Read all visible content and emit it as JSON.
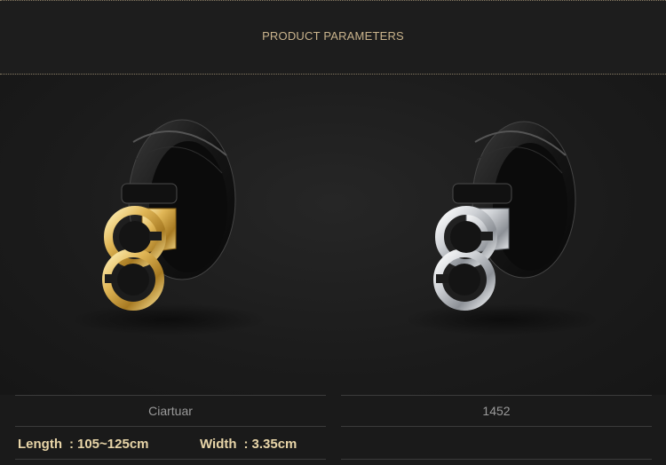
{
  "header": {
    "title": "PRODUCT PARAMETERS"
  },
  "products": [
    {
      "name": "Ciartuar",
      "buckle_color": "gold"
    },
    {
      "name": "1452",
      "buckle_color": "silver"
    }
  ],
  "specs": {
    "length_label": "Length",
    "length_value": "105~125cm",
    "width_label": "Width",
    "width_value": "3.35cm",
    "colon": ":"
  },
  "colors": {
    "background": "#1a1a1a",
    "header_text": "#c9b38c",
    "spec_text": "#e8d5a8",
    "name_text": "#9a9a9a"
  }
}
